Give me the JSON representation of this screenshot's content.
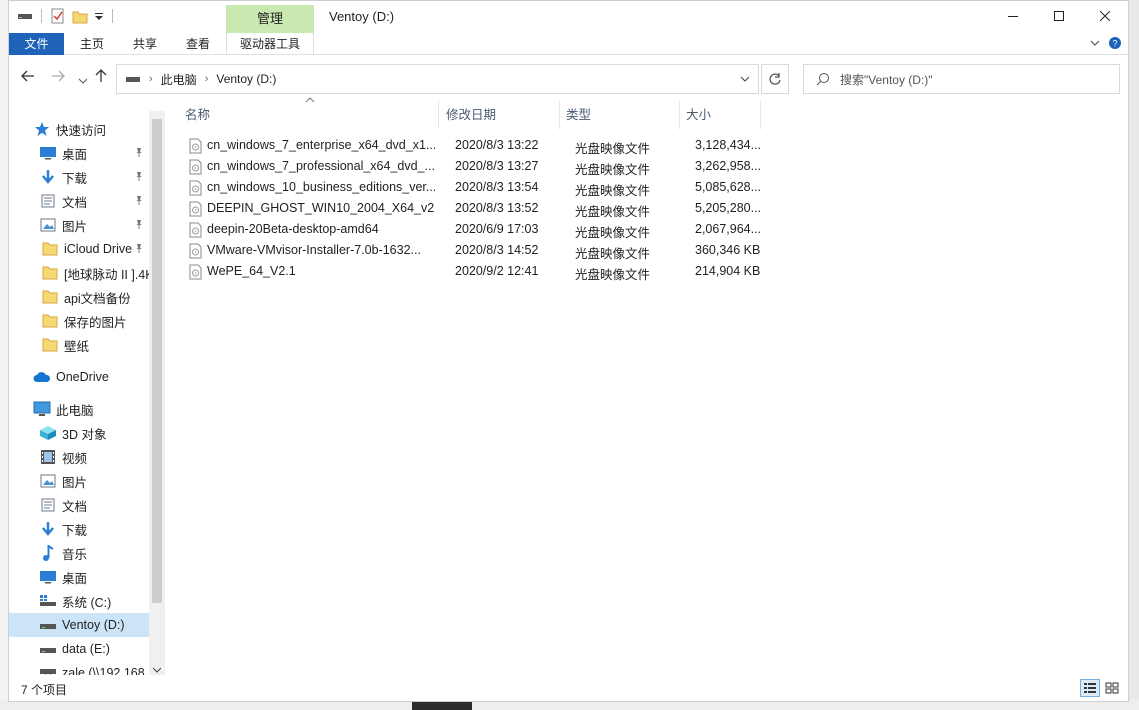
{
  "window": {
    "title": "Ventoy (D:)",
    "manage_tab": "管理"
  },
  "ribbon": {
    "tabs": [
      "文件",
      "主页",
      "共享",
      "查看",
      "驱动器工具"
    ]
  },
  "address": {
    "path": [
      "此电脑",
      "Ventoy (D:)"
    ],
    "search_placeholder": "搜索\"Ventoy (D:)\""
  },
  "nav": {
    "items": [
      {
        "label": "快速访问",
        "icon": "star-icon",
        "pinned": false
      },
      {
        "label": "桌面",
        "icon": "desktop-icon",
        "pinned": true
      },
      {
        "label": "下载",
        "icon": "download-icon",
        "pinned": true
      },
      {
        "label": "文档",
        "icon": "document-icon",
        "pinned": true
      },
      {
        "label": "图片",
        "icon": "picture-icon",
        "pinned": true
      },
      {
        "label": "iCloud Drive",
        "icon": "folder-icon",
        "pinned": true
      },
      {
        "label": "[地球脉动 II ].4K",
        "icon": "folder-icon",
        "pinned": false
      },
      {
        "label": "api文档备份",
        "icon": "folder-icon",
        "pinned": false
      },
      {
        "label": "保存的图片",
        "icon": "folder-icon",
        "pinned": false
      },
      {
        "label": "壁纸",
        "icon": "folder-icon",
        "pinned": false
      },
      {
        "label": "OneDrive",
        "icon": "cloud-icon",
        "pinned": false
      },
      {
        "label": "此电脑",
        "icon": "computer-icon",
        "pinned": false
      },
      {
        "label": "3D 对象",
        "icon": "cube-icon",
        "pinned": false
      },
      {
        "label": "视频",
        "icon": "video-icon",
        "pinned": false
      },
      {
        "label": "图片",
        "icon": "picture-icon",
        "pinned": false
      },
      {
        "label": "文档",
        "icon": "document-icon",
        "pinned": false
      },
      {
        "label": "下载",
        "icon": "download-icon",
        "pinned": false
      },
      {
        "label": "音乐",
        "icon": "music-icon",
        "pinned": false
      },
      {
        "label": "桌面",
        "icon": "desktop-icon",
        "pinned": false
      },
      {
        "label": "系统 (C:)",
        "icon": "system-drive-icon",
        "pinned": false
      },
      {
        "label": "Ventoy (D:)",
        "icon": "drive-icon",
        "pinned": false,
        "selected": true
      },
      {
        "label": "data (E:)",
        "icon": "drive-icon",
        "pinned": false
      },
      {
        "label": "zale (\\\\192.168",
        "icon": "network-drive-icon",
        "pinned": false
      }
    ]
  },
  "list": {
    "columns": [
      "名称",
      "修改日期",
      "类型",
      "大小"
    ],
    "files": [
      {
        "name": "cn_windows_7_enterprise_x64_dvd_x1...",
        "date": "2020/8/3 13:22",
        "type": "光盘映像文件",
        "size": "3,128,434..."
      },
      {
        "name": "cn_windows_7_professional_x64_dvd_...",
        "date": "2020/8/3 13:27",
        "type": "光盘映像文件",
        "size": "3,262,958..."
      },
      {
        "name": "cn_windows_10_business_editions_ver...",
        "date": "2020/8/3 13:54",
        "type": "光盘映像文件",
        "size": "5,085,628..."
      },
      {
        "name": "DEEPIN_GHOST_WIN10_2004_X64_v2...",
        "date": "2020/8/3 13:52",
        "type": "光盘映像文件",
        "size": "5,205,280..."
      },
      {
        "name": "deepin-20Beta-desktop-amd64",
        "date": "2020/6/9 17:03",
        "type": "光盘映像文件",
        "size": "2,067,964..."
      },
      {
        "name": "VMware-VMvisor-Installer-7.0b-1632...",
        "date": "2020/8/3 14:52",
        "type": "光盘映像文件",
        "size": "360,346 KB"
      },
      {
        "name": "WePE_64_V2.1",
        "date": "2020/9/2 12:41",
        "type": "光盘映像文件",
        "size": "214,904 KB"
      }
    ]
  },
  "status": {
    "count": "7 个项目"
  },
  "colors": {
    "accent": "#1e63b8",
    "manage_tab": "#c9e9b0",
    "selected": "#cce4f7"
  }
}
